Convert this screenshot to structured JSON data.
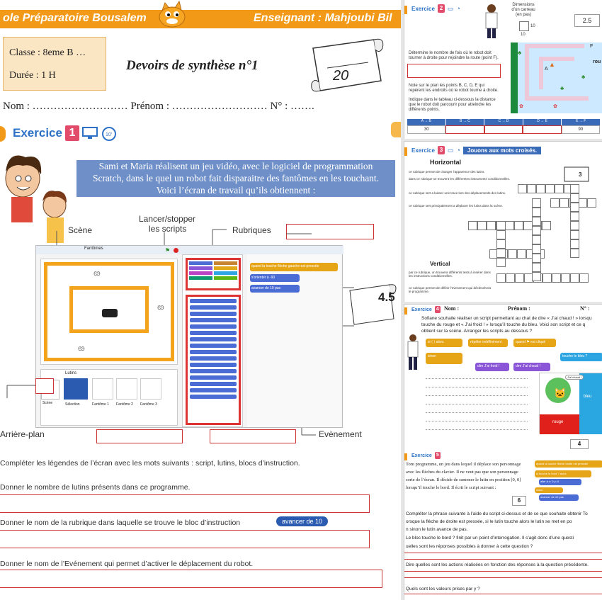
{
  "header": {
    "school": "ole Préparatoire Bousalem",
    "teacher": "Enseignant : Mahjoubi Bil",
    "classe": "Classe : 8eme B …",
    "duree": "Durée : 1 H",
    "title": "Devoirs de synthèse n°1",
    "score": "20",
    "name_line": "Nom : ……………………… Prénom : ……………………… N° : ……."
  },
  "ex1": {
    "label": "Exercice",
    "number": "1",
    "intro_1": "Sami et Maria réalisent un jeu vidéo, avec le logiciel de programmation",
    "intro_2": "Scratch, dans le quel un robot fait disparaitre des fantômes en les touchant.",
    "intro_3": "Voici l’écran de travail qu’ils obtiennent :",
    "lbl_scene": "Scène",
    "lbl_lancer": "Lancer/stopper",
    "lbl_scripts": "les scripts",
    "lbl_rubriques": "Rubriques",
    "lbl_arriere": "Arrière-plan",
    "lbl_evenement": "Evènement",
    "score": "4.5",
    "scratch_title": "Fantômes",
    "sprites_title": "Lutins",
    "scene_label": "Scène",
    "stage_sprites": [
      "Sélection",
      "Fantôme 1",
      "Fantôme 2",
      "Fantôme 3"
    ],
    "script_block_1": "quand la touche  flèche gauche  est pressée",
    "script_block_2": "s'orienter à  -90",
    "script_block_3": "avancer de  10  pas",
    "q1": "Compléter les légendes de l’écran avec les mots suivants : script, lutins, blocs d’instruction.",
    "q2": "Donner le nombre de lutins présents dans ce programme.",
    "q3": "Donner le nom de la rubrique dans laquelle se trouve le bloc d’instruction",
    "q3_block": "avancer de 10",
    "q4": "Donner le nom de l’Evénement qui permet d’activer le déplacement du robot."
  },
  "ex2": {
    "label": "Exercice",
    "number": "2",
    "dim_1": "Dimensions",
    "dim_2": "d’un carreau",
    "dim_3": "(en pas)",
    "dim_v1": "10",
    "dim_v2": "10",
    "score": "2.5",
    "inst_1": "Détermine le nombre de fois où le robot doit tourner à droite pour rejoindre la route (point F).",
    "inst_2": "Note sur le plan les points B, C, D, E qui repèrent les endroits où le robot tourne à droite.",
    "inst_3": "Indique dans le tableau ci-dessous la distance que le robot doit parcourir pour atteindre les différents points.",
    "table_head": [
      "A → B",
      "B → C",
      "C → D",
      "D → E",
      "E → F"
    ],
    "table_vals": [
      "30",
      "",
      "",
      "",
      "90"
    ],
    "map_a": "A",
    "map_f": "F",
    "map_road": "rou"
  },
  "ex3": {
    "label": "Exercice",
    "number": "3",
    "banner": "Jouons aux mots croisés.",
    "horizontal": "Horizontal",
    "vertical": "Vertical",
    "score": "3",
    "h_clues": [
      "ce rubrique permet de changer l’apparence des lutins.",
      "dans ce rubrique se trouvent les différentes instruments conditionnelles.",
      "ce rubrique sert a laisser une trace lors des déplacements des lutins.",
      "ce rubrique sert principalement a déplacer les lutins dans la scène."
    ],
    "v_clues": [
      "par ce rubrique, on trouvera différents tests à insérer dans les instructions conditionnelles.",
      "ce rubrique permet de définir l’evenement qui déclenchera le programme."
    ]
  },
  "ex4": {
    "label": "Exercice",
    "number": "4",
    "nom": "Nom :",
    "prenom": "Prénom :",
    "numero": "N° :",
    "text_1": "Sofiane souhaite réaliser un script permettant au chat de dire « J’ai chaud ! » lorsqu",
    "text_2": "touche du rouge et « J’ai froid ! » lorsqu’il touche du bleu. Voici son script et ce q",
    "text_3": "obtient sur la scène. Arranger les scripts au dessous ?",
    "blk_si": "si",
    "blk_alors": "alors",
    "blk_sinon": "sinon",
    "blk_repeter": "répéter indéfiniment",
    "blk_quand": "quand",
    "blk_clique": "est cliqué",
    "blk_touche": "touche le",
    "blk_bleu": "bleu",
    "blk_dire1": "dire",
    "blk_froid": "J’ai froid !",
    "blk_dire2": "dire",
    "blk_chaud": "J’ai chaud !",
    "stage_chaud": "J’ai chaud !",
    "stage_bleu": "bleu",
    "stage_rouge": "rouge",
    "score": "4"
  },
  "ex5": {
    "label": "Exercice",
    "number": "5",
    "text_1": "Tom programme, un jeu dans lequel il déplace son personnage",
    "text_2": "avec les flèches du clavier. Il ne veut pas que son personnage",
    "text_3": "sorte de l’écran. Il décide de ramener le lutin en position [0, 0]",
    "text_4": "lorsqu’il touche le bord. Il écrit le script suivant :",
    "score": "6",
    "s_quand": "quand la touche  flèche droite  est pressée",
    "s_si": "si  touche le  bord  ?  alors",
    "s_aller": "aller à x: 0  y: 0",
    "s_sinon": "sinon",
    "s_avancer": "avancer de  10  pas",
    "q1": "Compléter la phrase suivante à l’aide du script ci-dessus et de ce que souhaite obtenir To",
    "q1b": "orsque la flèche de droite est pressée, si le lutin touche          alors le lutin se met en po",
    "q1c": "n          sinon le lutin avance de          pas.",
    "q2": "Le bloc  touche le  bord  ?  finit par un point d’interrogation. Il s’agit donc d’une questi",
    "q2b": "uelles sont les réponses possibles à donner à cette question ?",
    "q3": "Dire quelles sont les actions réalisées en fonction des réponses à la question précédente.",
    "q4": "Quels sont les valeurs prises par y ?"
  }
}
